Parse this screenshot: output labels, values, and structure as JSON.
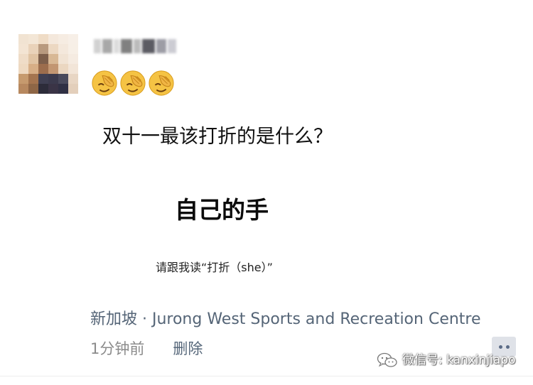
{
  "post": {
    "author_name": "",
    "question": "双十一最该打折的是什么？",
    "answer": "自己的手",
    "footnote": "请跟我读“打折（she）”",
    "location": "新加坡 · Jurong West Sports and Recreation Centre",
    "time": "1分钟前",
    "delete_label": "删除",
    "emoji": [
      "facepalm-emoji",
      "facepalm-emoji",
      "facepalm-emoji"
    ]
  },
  "actions": {
    "more_icon": "comment-dots-icon"
  },
  "watermark": {
    "text": "微信号: kanxinjiapo",
    "icon": "wechat-logo-icon"
  },
  "colors": {
    "link": "#56677a",
    "location": "#556577",
    "timestamp": "#8b8b8b",
    "emoji_face": "#f5c344"
  }
}
